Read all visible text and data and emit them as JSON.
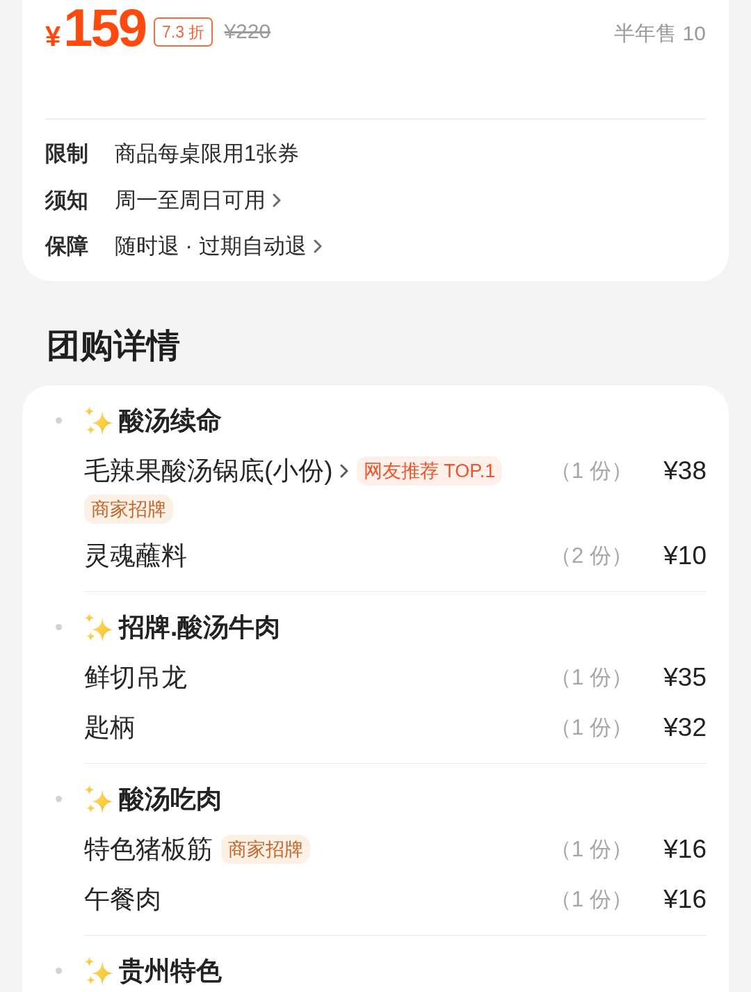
{
  "price": {
    "currency": "¥",
    "amount": "159",
    "discount": "7.3 折",
    "original": "¥220",
    "sales": "半年售 10"
  },
  "notes": [
    {
      "label": "限制",
      "value": "商品每桌限用1张券",
      "arrow": false
    },
    {
      "label": "须知",
      "value": "周一至周日可用",
      "arrow": true
    },
    {
      "label": "保障",
      "value": "随时退 · 过期自动退",
      "arrow": true
    }
  ],
  "details": {
    "title": "团购详情",
    "groups": [
      {
        "title": "酸汤续命",
        "items": [
          {
            "name": "毛辣果酸汤锅底(小份)",
            "arrow": true,
            "tags": [
              {
                "text": "网友推荐 TOP.1",
                "kind": "rank"
              },
              {
                "text": "商家招牌",
                "kind": "signature"
              }
            ],
            "quantity": "（1 份）",
            "price": "¥38"
          },
          {
            "name": "灵魂蘸料",
            "arrow": false,
            "quantity": "（2 份）",
            "price": "¥10"
          }
        ]
      },
      {
        "title": "招牌.酸汤牛肉",
        "items": [
          {
            "name": "鲜切吊龙",
            "arrow": false,
            "quantity": "（1 份）",
            "price": "¥35"
          },
          {
            "name": "匙柄",
            "arrow": false,
            "quantity": "（1 份）",
            "price": "¥32"
          }
        ]
      },
      {
        "title": "酸汤吃肉",
        "items": [
          {
            "name": "特色猪板筋",
            "arrow": false,
            "tags": [
              {
                "text": "商家招牌",
                "kind": "signature"
              }
            ],
            "quantity": "（1 份）",
            "price": "¥16"
          },
          {
            "name": "午餐肉",
            "arrow": false,
            "quantity": "（1 份）",
            "price": "¥16"
          }
        ]
      },
      {
        "title": "贵州特色"
      }
    ]
  }
}
